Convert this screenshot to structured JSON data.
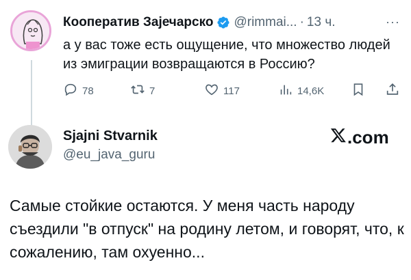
{
  "tweet1": {
    "name": "Кооператив Зајечарско",
    "handle": "@rimmai...",
    "separator": "·",
    "time": "13 ч.",
    "more": "···",
    "text": "а у вас тоже есть ощущение, что множество людей из эмиграции возвращаются в Россию?",
    "actions": {
      "replies": "78",
      "retweets": "7",
      "likes": "117",
      "views": "14,6K"
    }
  },
  "tweet2": {
    "name": "Sjajni Stvarnik",
    "handle": "@eu_java_guru",
    "brand": ".com",
    "text": "Самые стойкие остаются. У меня часть народу съездили \"в отпуск\" на родину летом, и говорят, что, к сожалению, там охуенно..."
  },
  "colors": {
    "text": "#0f1419",
    "secondary": "#536471",
    "verified": "#1d9bf0",
    "avatar_ring": "#e9a4d8"
  },
  "icons": [
    "verified-icon",
    "reply-icon",
    "retweet-icon",
    "like-icon",
    "views-icon",
    "bookmark-icon",
    "share-icon",
    "x-logo-icon"
  ]
}
